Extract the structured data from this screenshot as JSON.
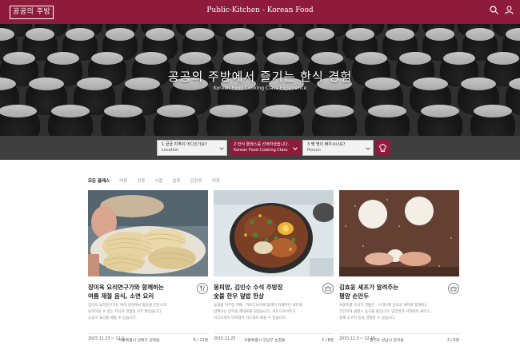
{
  "header": {
    "logo_text": "공공의 주방",
    "site_title": "Public-Kitchen - Korean Food"
  },
  "hero": {
    "title": "공공의 주방에서 즐기는 한식 경험",
    "subtitle": "Korean Food Cooking Class Experience"
  },
  "search": {
    "fields": [
      {
        "question": "1  궁금 지역이 어디신가요?",
        "answer": "Location",
        "active": false
      },
      {
        "question": "2  한식 클래스를 선택하셨습니다.",
        "answer": "Korean Food Cooking Class",
        "active": true
      },
      {
        "question": "3  몇 명이 배우시나요?",
        "answer": "Person",
        "active": false
      }
    ]
  },
  "tabs": [
    "모든 클래스",
    "떡류",
    "장류",
    "사찰",
    "술류",
    "김장류",
    "떡류"
  ],
  "cards": [
    {
      "title_lines": [
        "장미옥 요리연구가와 함께하는",
        "여름 제철 음식, 소면 요리"
      ],
      "desc_lines": [
        "장미옥 요리연구가는 여러 방면에서 활동을 전문으로",
        "요리하실 수 있는 지식과 경험을 모두 쌓았습니다.",
        "공동이 요리를 배울 수 있습니다."
      ],
      "date": "2015.11.23 ~ 12.2",
      "location": "서울특별시 성북구 성북동",
      "count": "6 / 12명"
    },
    {
      "title_lines": [
        "봉피양, 김민수 수석 주방장",
        "숯불 한우 덮밥 한상"
      ],
      "desc_lines": [
        "농협을 지키한 지배 · 카토드보이에 플레이 자매하던 세트와",
        "함께하는 한우의 제대로를 담았습니다. 카토드보이추가",
        "어그니파이 아카데미 카드래터 배울 수 있습니다."
      ],
      "date": "2015.11.25",
      "location": "서울특별시 강남구 논현동",
      "count": "3 / 8명"
    },
    {
      "title_lines": [
        "김효윤 셰프가 알려주는",
        "평양 손만두"
      ],
      "desc_lines": [
        "서울특별 미식가 전통은 · 스테나웨 김효윤 셰프와 함께하는",
        "간단하게 클래스 음식을 즐깁니다. 임전면과 아카데미 셰리스,",
        "함께 소우티 동을 경험할 수 있습니다."
      ],
      "date": "2015.12.3 ~ 12.15",
      "location": "경기도 성남시 장미동",
      "count": "3 / 6명"
    }
  ],
  "colors": {
    "brand": "#8e1a3c",
    "search_bg": "#3f3f3f"
  }
}
